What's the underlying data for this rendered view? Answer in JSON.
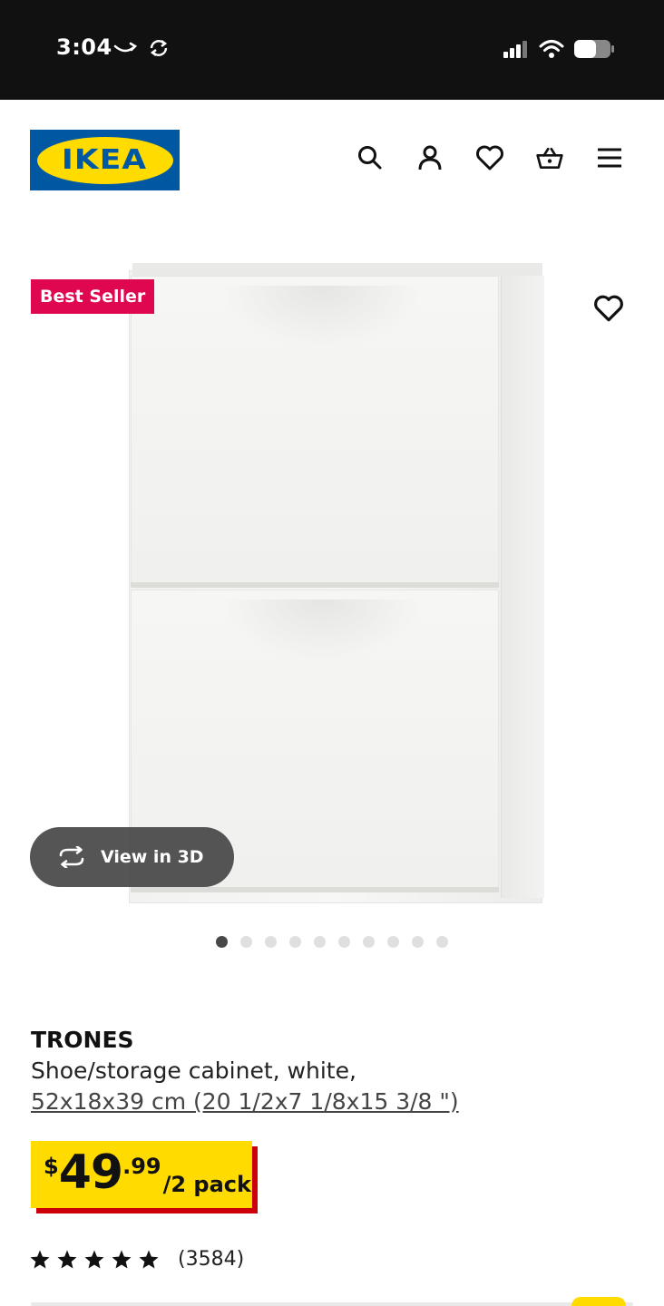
{
  "status_bar": {
    "time": "3:04"
  },
  "header": {
    "logo_text": "IKEA",
    "icons": [
      "search-icon",
      "account-icon",
      "heart-icon",
      "basket-icon",
      "menu-icon"
    ]
  },
  "media": {
    "badge": "Best Seller",
    "view_3d_label": "View in 3D",
    "image_count": 10,
    "active_image_index": 0
  },
  "product": {
    "name": "TRONES",
    "description": "Shoe/storage cabinet, white,",
    "dimensions": "52x18x39 cm (20 1/2x7 1/8x15 3/8 \")"
  },
  "price": {
    "currency": "$",
    "integer": "49",
    "decimal": ".99",
    "unit": "/2 pack"
  },
  "rating": {
    "stars": 5,
    "count": "(3584)"
  },
  "colors": {
    "ikea_blue": "#0058a3",
    "ikea_yellow": "#ffdb00",
    "badge_red": "#e00751",
    "price_shadow_red": "#cc0008"
  }
}
